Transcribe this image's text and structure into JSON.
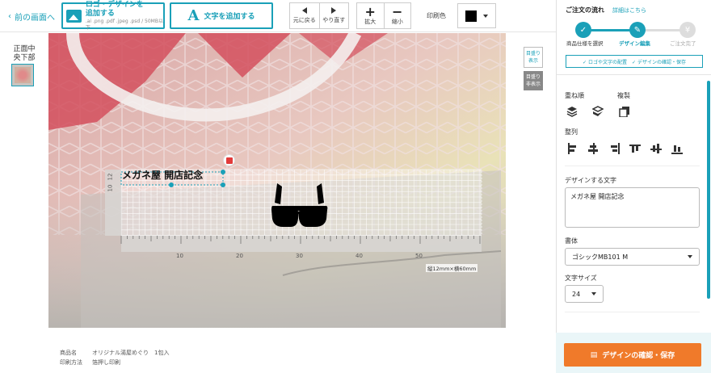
{
  "toolbar": {
    "back_label": "前の画面へ",
    "logo_title1": "ロゴ・デザインを",
    "logo_title2": "追加する",
    "logo_formats": ".ai .png .pdf .jpeg .psd / 50MB以下",
    "text_button_label": "文字を追加する",
    "undo_label": "元に戻る",
    "redo_label": "やり直す",
    "zoom_in_label": "拡大",
    "zoom_out_label": "縮小",
    "print_color_label": "印刷色",
    "print_color_value": "#000000"
  },
  "views": {
    "current_label_line1": "正面中",
    "current_label_line2": "央下部"
  },
  "canvas": {
    "design_text": "メガネ屋 開店記念",
    "size_label": "縦12mm×横60mm",
    "ruler_x_ticks": [
      "10",
      "20",
      "30",
      "40",
      "50"
    ],
    "ruler_y_ticks": [
      "12",
      "10"
    ],
    "grid_show": "目盛り表示",
    "grid_hide": "目盛り非表示"
  },
  "product": {
    "name_label": "商品名",
    "name_value": "オリジナル湯屋めぐり　1包入",
    "method_label": "印刷方法",
    "method_value": "箔押し印刷"
  },
  "panel": {
    "title": "ご注文の流れ",
    "detail_link": "詳細はこちら",
    "steps": [
      "商品仕様を選択",
      "デザイン編集",
      "ご注文完了"
    ],
    "flow_notes": [
      "ロゴや文字の配置",
      "デザインの確認・保存"
    ],
    "layer_order_label": "重ね順",
    "duplicate_label": "複製",
    "align_label": "整列",
    "design_text_label": "デザインする文字",
    "design_text_value": "メガネ屋 開店記念",
    "font_label": "書体",
    "font_value": "ゴシックMB101 M",
    "font_size_label": "文字サイズ",
    "font_size_value": "24",
    "save_button": "デザインの確認・保存"
  },
  "colors": {
    "accent": "#1aa0b8",
    "save": "#f07a2a"
  }
}
